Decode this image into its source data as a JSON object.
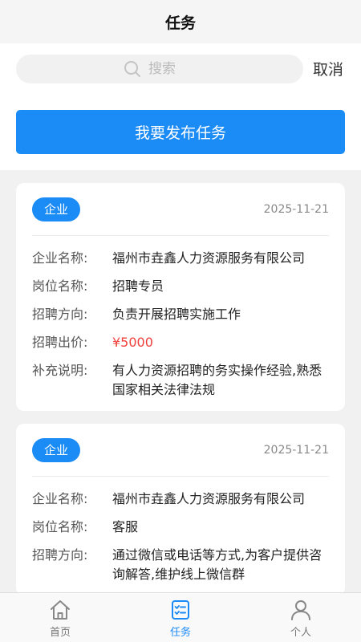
{
  "header": {
    "title": "任务"
  },
  "search": {
    "placeholder": "搜索",
    "cancel_label": "取消"
  },
  "publish_label": "我要发布任务",
  "colors": {
    "accent": "#1b8bf5",
    "price": "#f0403c"
  },
  "labels": {
    "company": "企业名称:",
    "position": "岗位名称:",
    "direction": "招聘方向:",
    "price": "招聘出价:",
    "note": "补充说明:"
  },
  "tasks": [
    {
      "type": "企业",
      "date": "2025-11-21",
      "company": "福州市垚鑫人力资源服务有限公司",
      "position": "招聘专员",
      "direction": "负责开展招聘实施工作",
      "price": "¥5000",
      "note": "有人力资源招聘的务实操作经验,熟悉国家相关法律法规"
    },
    {
      "type": "企业",
      "date": "2025-11-21",
      "company": "福州市垚鑫人力资源服务有限公司",
      "position": "客服",
      "direction": "通过微信或电话等方式,为客户提供咨询解答,维护线上微信群"
    }
  ],
  "tabs": [
    {
      "label": "首页",
      "icon": "home-icon"
    },
    {
      "label": "任务",
      "icon": "task-list-icon",
      "active": true
    },
    {
      "label": "个人",
      "icon": "user-icon"
    }
  ]
}
